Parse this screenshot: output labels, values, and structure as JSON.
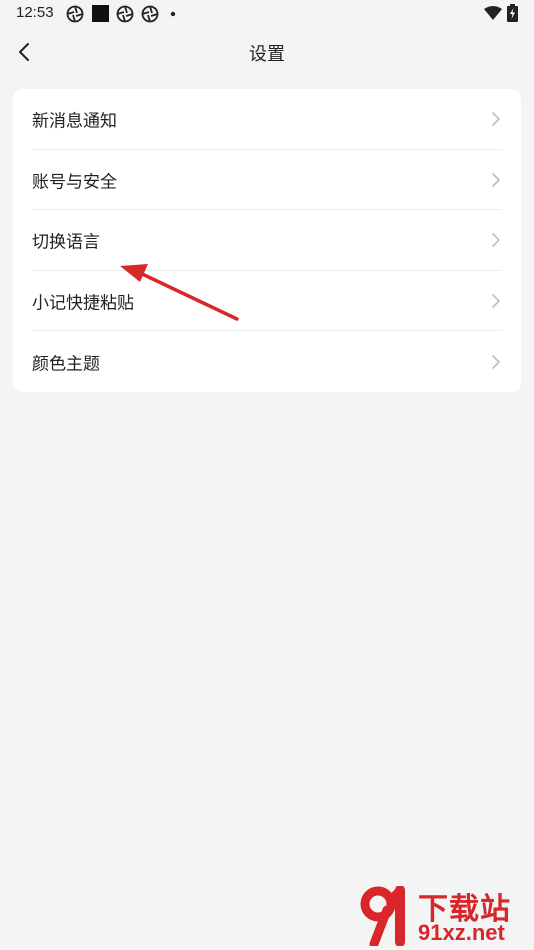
{
  "status_bar": {
    "time": "12:53"
  },
  "header": {
    "title": "设置"
  },
  "settings": {
    "items": [
      {
        "label": "新消息通知"
      },
      {
        "label": "账号与安全"
      },
      {
        "label": "切换语言"
      },
      {
        "label": "小记快捷粘贴"
      },
      {
        "label": "颜色主题"
      }
    ]
  },
  "watermark": {
    "top": "下载站",
    "bottom": "91xz.net"
  },
  "colors": {
    "background": "#f3f4f4",
    "card": "#ffffff",
    "annotation_arrow": "#d62a2a"
  }
}
